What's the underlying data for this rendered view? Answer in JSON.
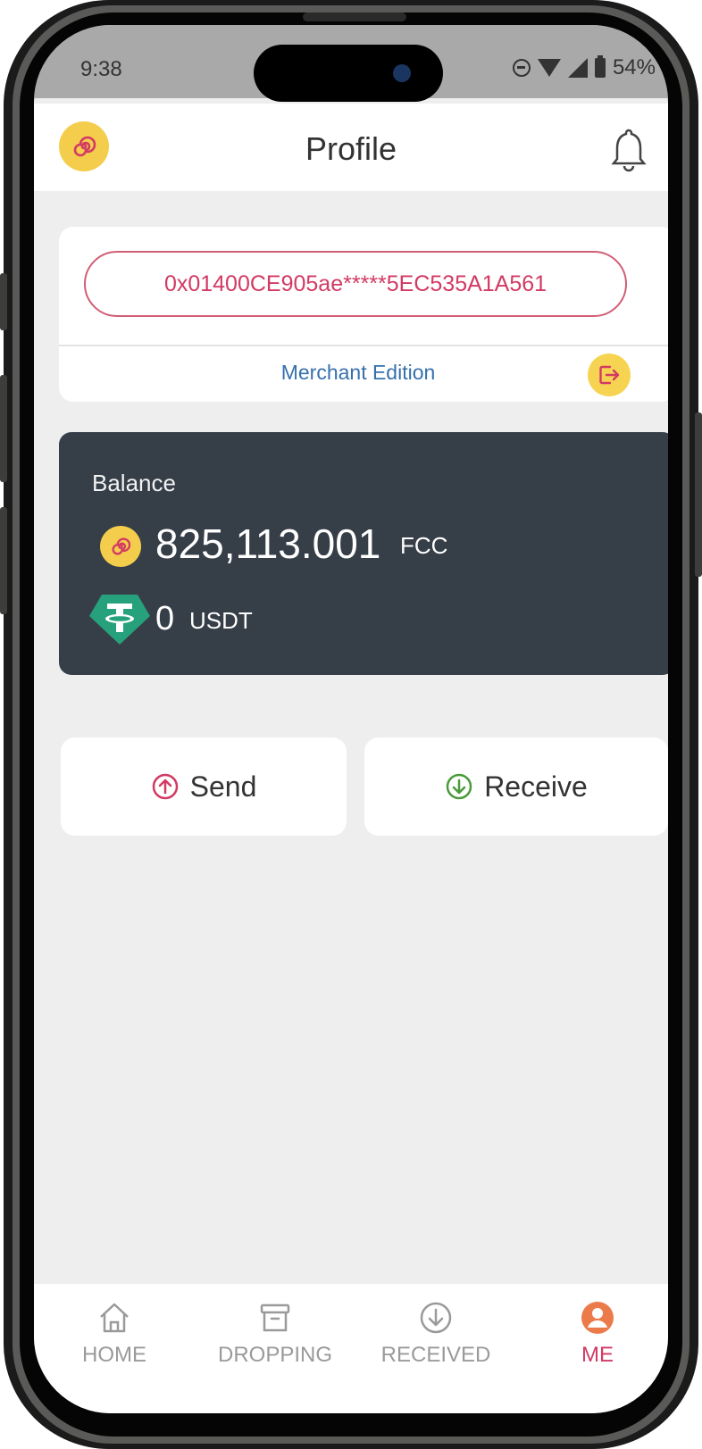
{
  "status_bar": {
    "time": "9:38",
    "battery": "54%"
  },
  "header": {
    "title": "Profile"
  },
  "wallet": {
    "address": "0x01400CE905ae*****5EC535A1A561",
    "edition": "Merchant Edition"
  },
  "balance": {
    "label": "Balance",
    "fcc_amount": "825,113.001",
    "fcc_unit": "FCC",
    "usdt_amount": "0",
    "usdt_unit": "USDT"
  },
  "actions": {
    "send_label": "Send",
    "receive_label": "Receive"
  },
  "nav": {
    "items": [
      {
        "label": "HOME",
        "icon": "home-icon"
      },
      {
        "label": "DROPPING",
        "icon": "archive-icon"
      },
      {
        "label": "RECEIVED",
        "icon": "download-circle-icon"
      },
      {
        "label": "ME",
        "icon": "user-circle-icon"
      }
    ],
    "active": "ME"
  },
  "colors": {
    "brand_pink": "#d23a64",
    "brand_yellow": "#f4cd4c",
    "card_dark": "#363e48",
    "link_blue": "#3670ad",
    "receive_green": "#4a9b3b",
    "usdt_teal": "#26a17b"
  }
}
